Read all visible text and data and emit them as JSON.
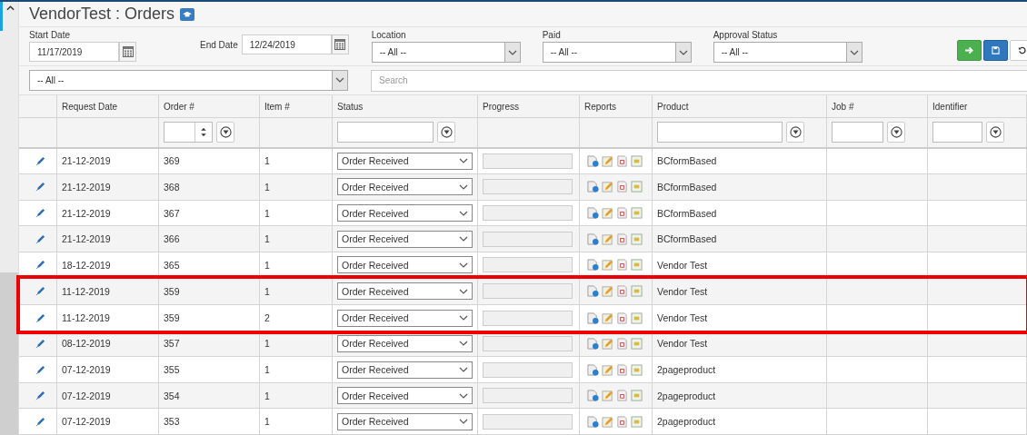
{
  "page": {
    "title": "VendorTest : Orders"
  },
  "filters": {
    "start_date": {
      "label": "Start Date",
      "value": "11/17/2019"
    },
    "end_date": {
      "label": "End Date",
      "value": "12/24/2019"
    },
    "location": {
      "label": "Location",
      "value": "-- All --"
    },
    "paid": {
      "label": "Paid",
      "value": "-- All --"
    },
    "approval_status": {
      "label": "Approval Status",
      "value": "-- All --"
    },
    "scope": {
      "value": "-- All --"
    },
    "search": {
      "placeholder": "Search"
    }
  },
  "table": {
    "columns": [
      {
        "label": "Request Date",
        "kind": "plain"
      },
      {
        "label": "Order #",
        "kind": "number_filter"
      },
      {
        "label": "Item #",
        "kind": "plain"
      },
      {
        "label": "Status",
        "kind": "text_filter"
      },
      {
        "label": "Progress",
        "kind": "plain"
      },
      {
        "label": "Reports",
        "kind": "plain"
      },
      {
        "label": "Product",
        "kind": "text_filter"
      },
      {
        "label": "Job #",
        "kind": "text_filter"
      },
      {
        "label": "Identifier",
        "kind": "text_filter"
      }
    ],
    "rows": [
      {
        "request_date": "21-12-2019",
        "order": "369",
        "item": "1",
        "status": "Order Received",
        "product": "BCformBased",
        "highlighted": false
      },
      {
        "request_date": "21-12-2019",
        "order": "368",
        "item": "1",
        "status": "Order Received",
        "product": "BCformBased",
        "highlighted": false
      },
      {
        "request_date": "21-12-2019",
        "order": "367",
        "item": "1",
        "status": "Order Received",
        "product": "BCformBased",
        "highlighted": false
      },
      {
        "request_date": "21-12-2019",
        "order": "366",
        "item": "1",
        "status": "Order Received",
        "product": "BCformBased",
        "highlighted": false
      },
      {
        "request_date": "18-12-2019",
        "order": "365",
        "item": "1",
        "status": "Order Received",
        "product": "Vendor Test",
        "highlighted": false
      },
      {
        "request_date": "11-12-2019",
        "order": "359",
        "item": "1",
        "status": "Order Received",
        "product": "Vendor Test",
        "highlighted": true
      },
      {
        "request_date": "11-12-2019",
        "order": "359",
        "item": "2",
        "status": "Order Received",
        "product": "Vendor Test",
        "highlighted": true
      },
      {
        "request_date": "08-12-2019",
        "order": "357",
        "item": "1",
        "status": "Order Received",
        "product": "Vendor Test",
        "highlighted": false
      },
      {
        "request_date": "07-12-2019",
        "order": "355",
        "item": "1",
        "status": "Order Received",
        "product": "2pageproduct",
        "highlighted": false
      },
      {
        "request_date": "07-12-2019",
        "order": "354",
        "item": "1",
        "status": "Order Received",
        "product": "2pageproduct",
        "highlighted": false
      },
      {
        "request_date": "07-12-2019",
        "order": "353",
        "item": "1",
        "status": "Order Received",
        "product": "2pageproduct",
        "highlighted": false
      }
    ]
  }
}
